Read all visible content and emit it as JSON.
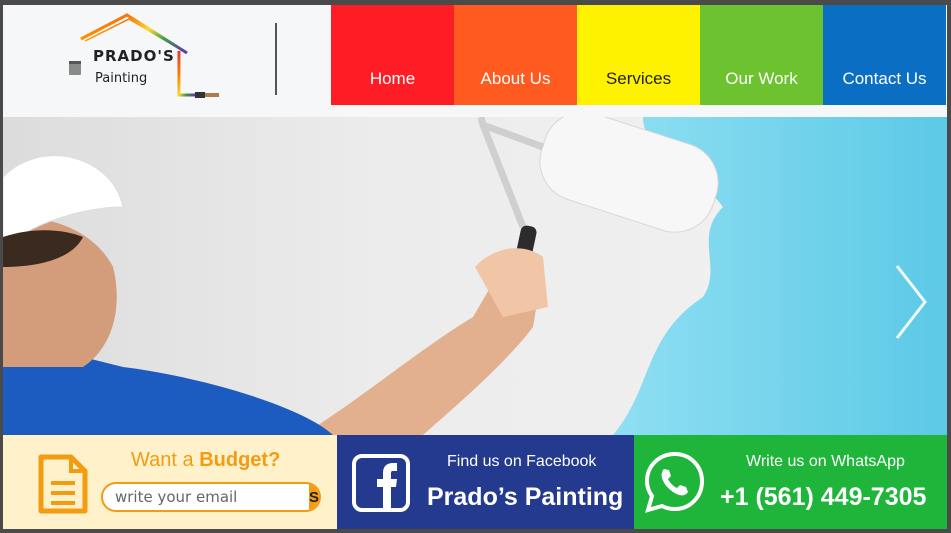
{
  "logo": {
    "title": "PRADO'S",
    "subtitle": "Painting"
  },
  "nav": {
    "items": [
      {
        "label": "Home",
        "bg": "#ff1d25",
        "color": "#ffffff"
      },
      {
        "label": "About Us",
        "bg": "#ff5a1f",
        "color": "#ffffff"
      },
      {
        "label": "Services",
        "bg": "#fff200",
        "color": "#222222"
      },
      {
        "label": "Our Work",
        "bg": "#6cc22f",
        "color": "#ffffff"
      },
      {
        "label": "Contact Us",
        "bg": "#0a6fc2",
        "color": "#ffffff"
      }
    ]
  },
  "hero": {
    "next_icon": "chevron-right-icon"
  },
  "budget": {
    "title_prefix": "Want a",
    "title_highlight": "Budget?",
    "input_placeholder": "write your email",
    "send_label": "Send",
    "icon": "document-icon"
  },
  "facebook": {
    "small": "Find us on Facebook",
    "big": "Prado’s Painting",
    "icon": "facebook-icon"
  },
  "whatsapp": {
    "small": "Write us on WhatsApp",
    "big": "+1 (561) 449-7305",
    "icon": "whatsapp-icon"
  },
  "colors": {
    "budget_orange": "#f39c12",
    "facebook_blue": "#243a8f",
    "whatsapp_green": "#1fb53a",
    "wall_blue": "#67d3ee"
  }
}
